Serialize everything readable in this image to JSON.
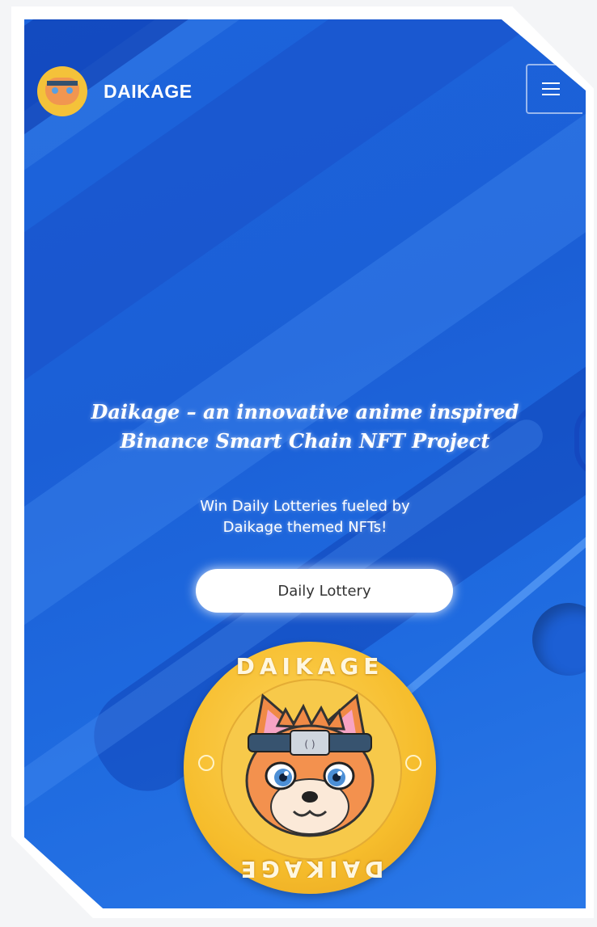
{
  "header": {
    "brand_name": "DAIKAGE",
    "logo_icon": "daikage-fox-logo",
    "menu_icon": "hamburger-menu-icon"
  },
  "hero": {
    "headline_line1": "Daikage – an innovative anime inspired",
    "headline_line2": "Binance Smart Chain NFT Project",
    "sub_line1": "Win Daily Lotteries fueled by",
    "sub_line2": "Daikage themed NFTs!",
    "cta_label": "Daily Lottery"
  },
  "coin": {
    "top_text": "DAIKAGE",
    "bottom_text": "DAIKAGE",
    "image": "daikage-fox-coin"
  },
  "colors": {
    "background": "#1c64dc",
    "coin_gold": "#f6bd2c",
    "cta_bg": "#ffffff",
    "text": "#ffffff"
  }
}
